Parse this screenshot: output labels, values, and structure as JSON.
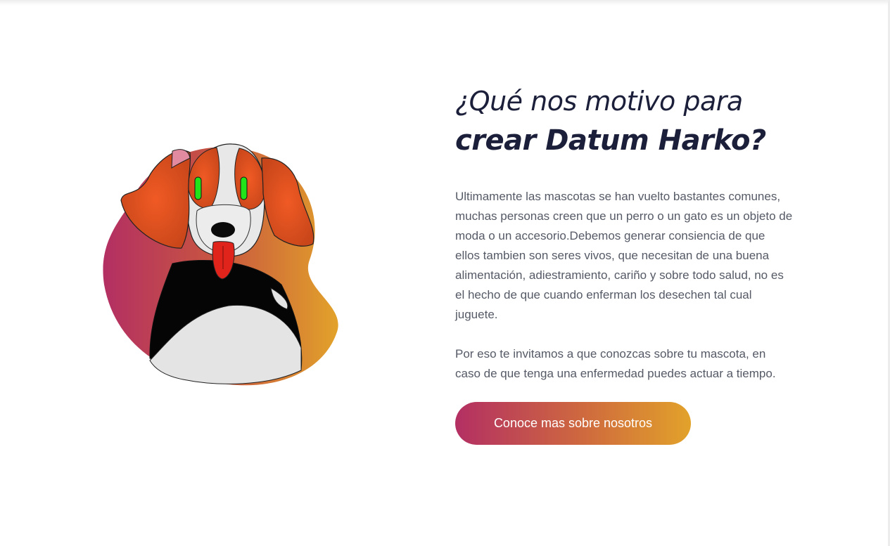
{
  "section": {
    "heading_line1": "¿Qué nos motivo para",
    "heading_line2": "crear Datum Harko?",
    "paragraph1": "Ultimamente las mascotas se han vuelto bastantes comunes, muchas personas creen que un perro o un gato es un objeto de moda o un accesorio.Debemos generar consiencia de que ellos tambien son seres vivos, que necesitan de una buena alimentación, adiestramiento, cariño y sobre todo salud, no es el hecho de que cuando enferman los desechen tal cual juguete.",
    "paragraph2": "Por eso te invitamos a que conozcas sobre tu mascota, en caso de que tenga una enfermedad puedes actuar a tiempo.",
    "cta_label": "Conoce mas sobre nosotros"
  },
  "illustration": {
    "icon": "dog-illustration",
    "blob_gradient": [
      "#b32f63",
      "#e2a22a"
    ]
  },
  "colors": {
    "heading": "#1c1f3a",
    "body_text": "#555a66",
    "button_start": "#b32f63",
    "button_end": "#e2a22a"
  }
}
